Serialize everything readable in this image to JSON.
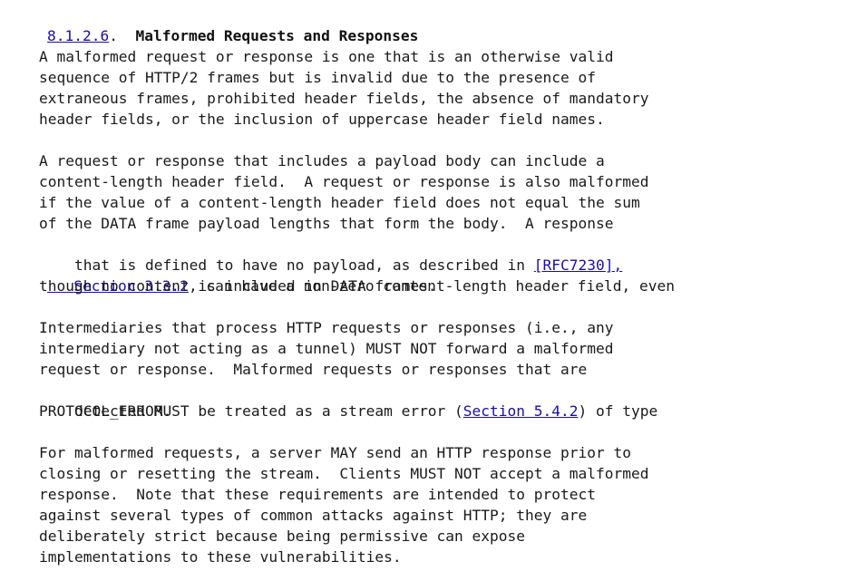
{
  "section": {
    "number_link": "8.1.2.6",
    "dot": ".",
    "title": "Malformed Requests and Responses"
  },
  "paragraphs": [
    {
      "lines": [
        "A malformed request or response is one that is an otherwise valid",
        "sequence of HTTP/2 frames but is invalid due to the presence of",
        "extraneous frames, prohibited header fields, the absence of mandatory",
        "header fields, or the inclusion of uppercase header field names."
      ]
    },
    {
      "lines": [
        "A request or response that includes a payload body can include a",
        "content-length header field.  A request or response is also malformed",
        "if the value of a content-length header field does not equal the sum",
        "of the DATA frame payload lengths that form the body.  A response"
      ],
      "line5_pre": "that is defined to have no payload, as described in ",
      "rfc_link": "[RFC7230],",
      "section_link_prefix": "   ",
      "section_link": "Section 3.3.2",
      "line6_post": ", can have a non-zero content-length header field, even",
      "line7": "though no content is included in DATA frames."
    },
    {
      "lines": [
        "Intermediaries that process HTTP requests or responses (i.e., any",
        "intermediary not acting as a tunnel) MUST NOT forward a malformed",
        "request or response.  Malformed requests or responses that are"
      ],
      "line4_pre": "detected MUST be treated as a stream error (",
      "section_link": "Section 5.4.2",
      "line4_post": ") of type",
      "line5": "PROTOCOL_ERROR."
    },
    {
      "lines": [
        "For malformed requests, a server MAY send an HTTP response prior to",
        "closing or resetting the stream.  Clients MUST NOT accept a malformed",
        "response.  Note that these requirements are intended to protect",
        "against several types of common attacks against HTTP; they are",
        "deliberately strict because being permissive can expose",
        "implementations to these vulnerabilities."
      ]
    }
  ],
  "colors": {
    "link": "#1a0dab",
    "text": "#1a1a1a"
  }
}
